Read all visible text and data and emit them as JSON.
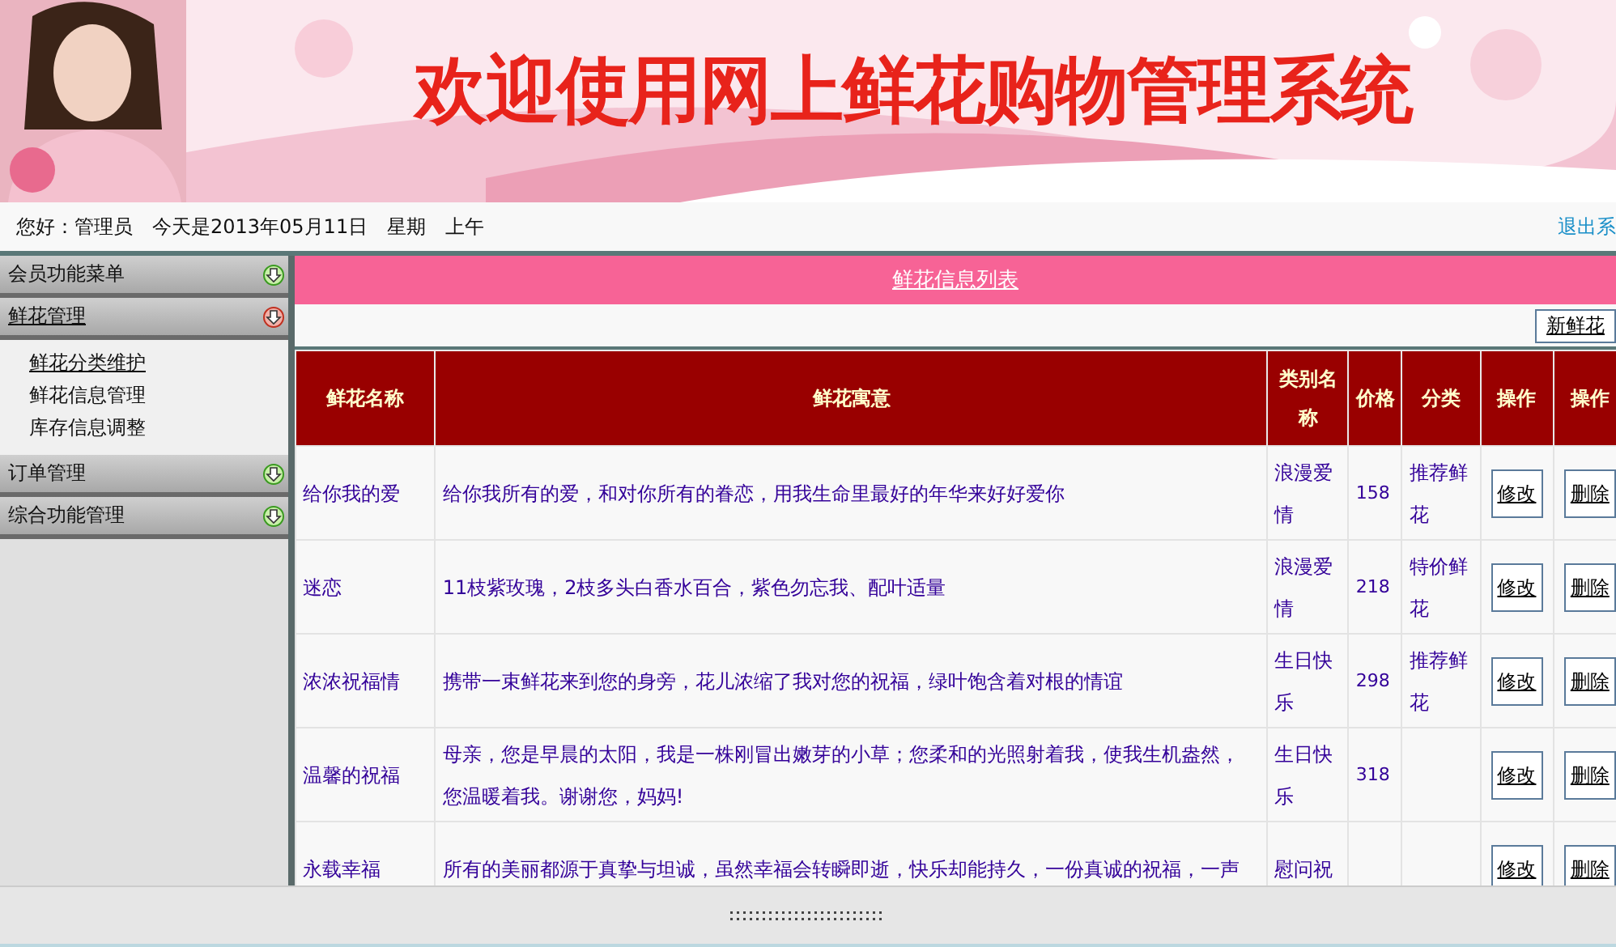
{
  "banner": {
    "title": "欢迎使用网上鲜花购物管理系统"
  },
  "status_bar": {
    "greeting": "您好：管理员",
    "date": "今天是2013年05月11日",
    "weekday": "星期",
    "period": "上午",
    "logout": "退出系"
  },
  "sidebar": {
    "items": [
      {
        "label": "会员功能菜单",
        "expanded": false
      },
      {
        "label": "鲜花管理",
        "expanded": true,
        "children": [
          {
            "label": "鲜花分类维护",
            "selected": true
          },
          {
            "label": "鲜花信息管理",
            "selected": false
          },
          {
            "label": "库存信息调整",
            "selected": false
          }
        ]
      },
      {
        "label": "订单管理",
        "expanded": false
      },
      {
        "label": "综合功能管理",
        "expanded": false
      }
    ]
  },
  "panel": {
    "title": "鲜花信息列表",
    "add_button": "新鲜花"
  },
  "table": {
    "columns": [
      "鲜花名称",
      "鲜花寓意",
      "类别名称",
      "价格",
      "分类",
      "操作",
      "操作"
    ],
    "rows": [
      {
        "name": "给你我的爱",
        "meaning": "给你我所有的爱，和对你所有的眷恋，用我生命里最好的年华来好好爱你",
        "category": "浪漫爱情",
        "price": "158",
        "type": "推荐鲜花",
        "edit": "修改",
        "delete": "删除"
      },
      {
        "name": "迷恋",
        "meaning": "11枝紫玫瑰，2枝多头白香水百合，紫色勿忘我、配叶适量",
        "category": "浪漫爱情",
        "price": "218",
        "type": "特价鲜花",
        "edit": "修改",
        "delete": "删除"
      },
      {
        "name": "浓浓祝福情",
        "meaning": "携带一束鲜花来到您的身旁，花儿浓缩了我对您的祝福，绿叶饱含着对根的情谊",
        "category": "生日快乐",
        "price": "298",
        "type": "推荐鲜花",
        "edit": "修改",
        "delete": "删除"
      },
      {
        "name": "温馨的祝福",
        "meaning": "母亲，您是早晨的太阳，我是一株刚冒出嫩芽的小草；您柔和的光照射着我，使我生机盎然，您温暖着我。谢谢您，妈妈!",
        "category": "生日快乐",
        "price": "318",
        "edit": "修改",
        "delete": "删除"
      },
      {
        "name": "永载幸福",
        "meaning": "所有的美丽都源于真挚与坦诚，虽然幸福会转瞬即逝，快乐却能持久，一份真诚的祝福，一声",
        "category": "慰问祝",
        "edit": "修改",
        "delete": "删除"
      }
    ]
  }
}
